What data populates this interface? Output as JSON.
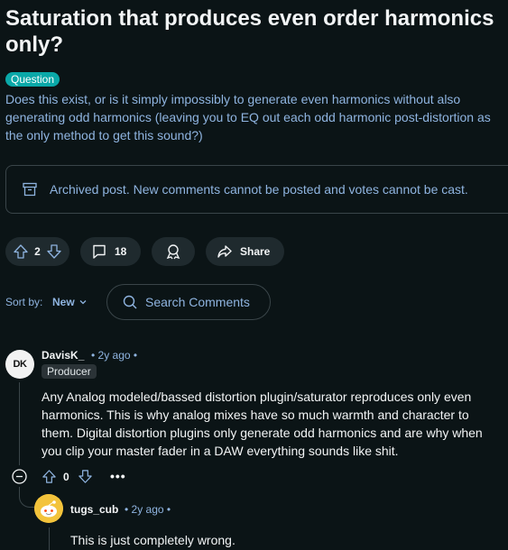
{
  "post": {
    "title": "Saturation that produces even order harmonics only?",
    "flair": "Question",
    "body": "Does this exist, or is it simply impossibly to generate even harmonics without also generating odd harmonics (leaving you to EQ out each odd harmonic post-distortion as the only method to get this sound?)",
    "archived_notice": "Archived post. New comments cannot be posted and votes cannot be cast."
  },
  "actions": {
    "score": "2",
    "comments": "18",
    "share_label": "Share",
    "icons": [
      "upvote-icon",
      "downvote-icon",
      "comment-icon",
      "award-icon",
      "share-icon"
    ]
  },
  "sort": {
    "label": "Sort by:",
    "value": "New"
  },
  "search": {
    "placeholder": "Search Comments"
  },
  "comments": [
    {
      "avatar_text": "DK",
      "author": "DavisK_",
      "meta": "• 2y ago •",
      "flair": "Producer",
      "text": "Any Analog modeled/bassed distortion plugin/saturator reproduces only even harmonics. This is why analog mixes have so much warmth and character to them. Digital distortion plugins only generate odd harmonics and are why when you clip your master fader in a DAW everything sounds like shit.",
      "score": "0",
      "more": "•••"
    },
    {
      "author": "tugs_cub",
      "meta": "• 2y ago •",
      "text": "This is just completely wrong."
    }
  ],
  "colors": {
    "background": "#0b1416",
    "accent_flair": "#0aa8a8",
    "link_blue": "#8fb4e0",
    "button_bg": "#1f2a2e",
    "avatar_yellow": "#f3c33b"
  }
}
